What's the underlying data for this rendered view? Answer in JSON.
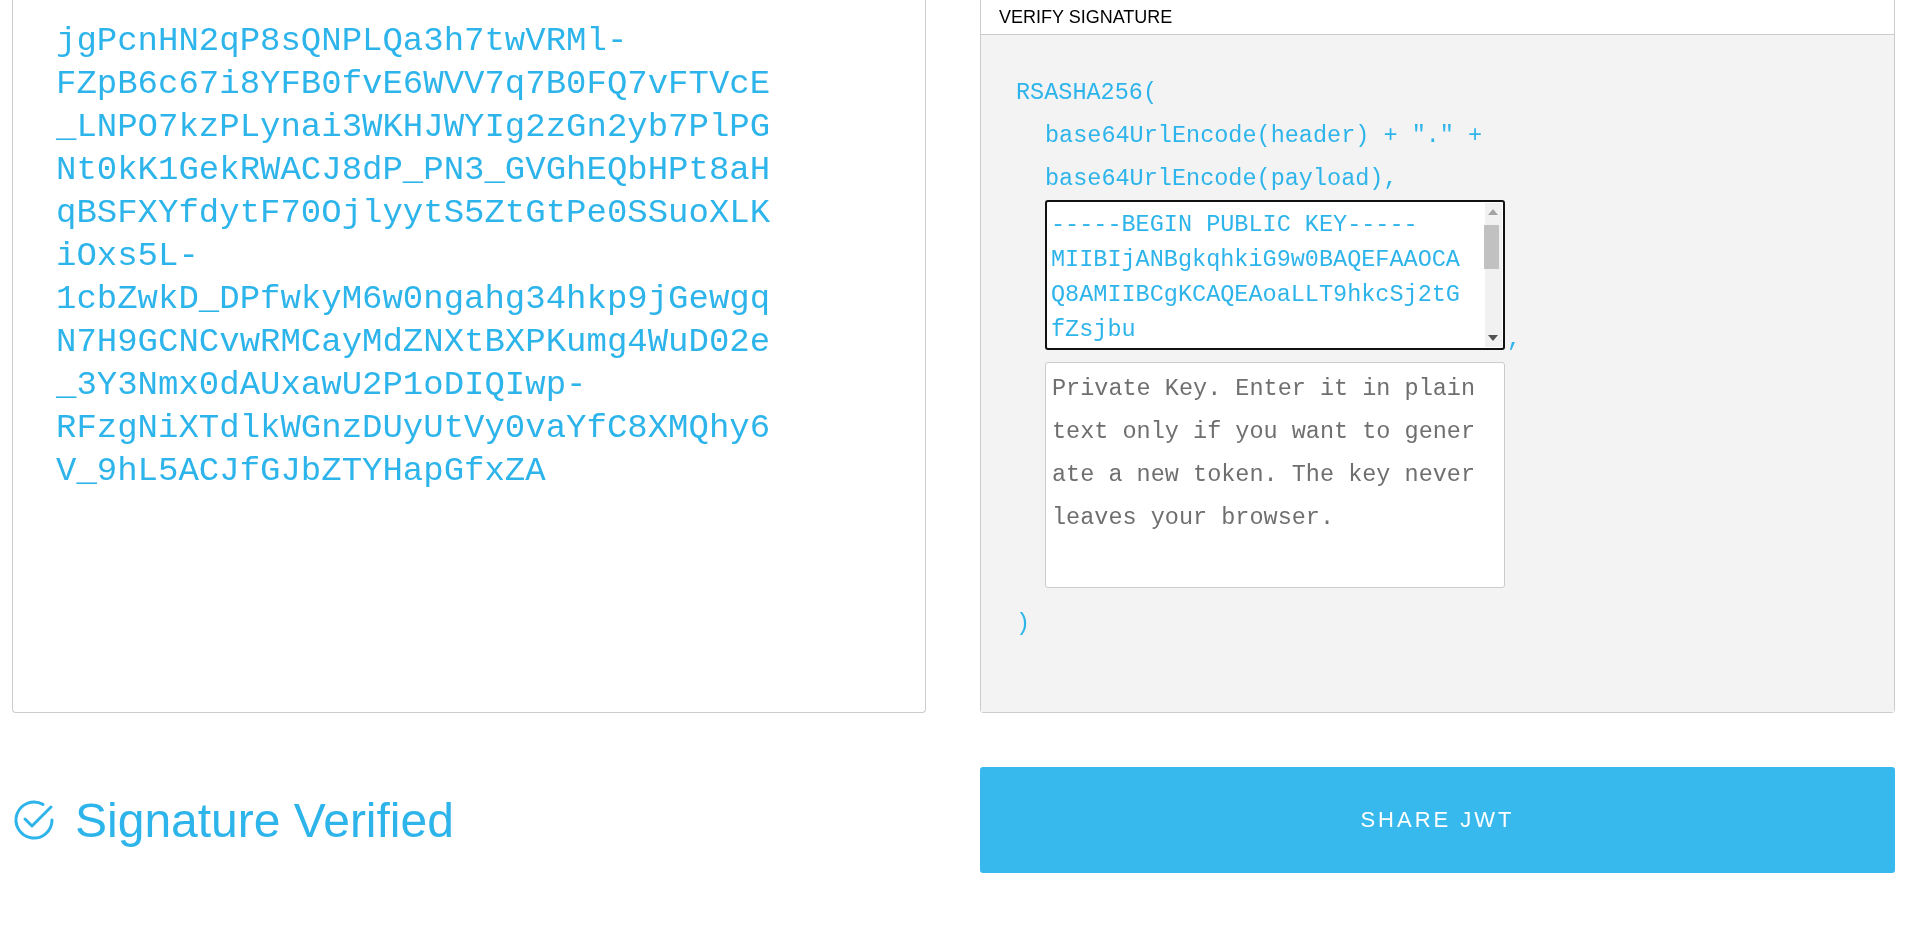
{
  "token_panel": {
    "text": "jgPcnHN2qP8sQNPLQa3h7twVRMl-FZpB6c67i8YFB0fvE6WVV7q7B0FQ7vFTVcE_LNPO7kzPLynai3WKHJWYIg2zGn2yb7PlPGNt0kK1GekRWACJ8dP_PN3_GVGhEQbHPt8aHqBSFXYfdytF70OjlyytS5ZtGtPe0SSuoXLKiOxs5L-1cbZwkD_DPfwkyM6w0ngahg34hkp9jGewgqN7H9GCNCvwRMCayMdZNXtBXPKumg4WuD02e_3Y3Nmx0dAUxawU2P1oDIQIwp-RFzgNiXTdlkWGnzDUyUtVy0vaYfC8XMQhy6V_9hL5ACJfGJbZTYHapGfxZA"
  },
  "verify_signature": {
    "title": "VERIFY SIGNATURE",
    "algorithm_open": "RSASHA256(",
    "header_arg": "base64UrlEncode(header) + \".\" +",
    "payload_arg": "base64UrlEncode(payload),",
    "public_key": {
      "lines": [
        "-----BEGIN PUBLIC KEY-----",
        "MIIBIjANBgkqhkiG9w0BAQEFAAOCA",
        "Q8AMIIBCgKCAQEAoaLLT9hkcSj2tG",
        "fZsjbu"
      ]
    },
    "separator": ",",
    "private_key": {
      "placeholder": "Private Key. Enter it in plain text only if you want to generate a new token. The key never leaves your browser."
    },
    "close": ")"
  },
  "status": {
    "text": "Signature Verified"
  },
  "share_button": {
    "label": "SHARE JWT"
  }
}
